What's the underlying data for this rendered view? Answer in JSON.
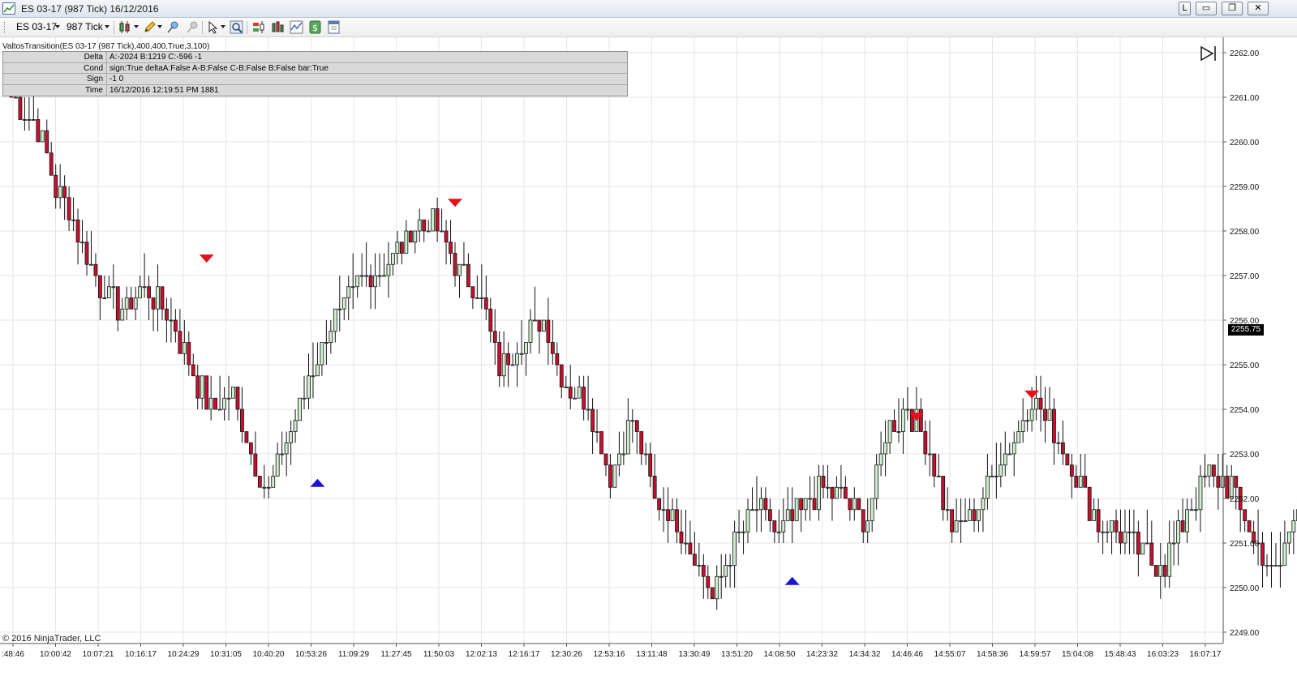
{
  "window": {
    "title": "ES 03-17 (987 Tick)  16/12/2016",
    "buttons": [
      "L",
      "▭",
      "❐",
      "✕"
    ]
  },
  "toolbar": {
    "instrument": "ES 03-17",
    "interval": "987 Tick"
  },
  "indicator": {
    "label": "ValtosTransition(ES 03-17 (987 Tick),400,400,True,3,100)",
    "rows": [
      {
        "key": "Delta",
        "value": "A:-2024 B:1219 C:-596 -1"
      },
      {
        "key": "Cond",
        "value": "sign:True deltaA:False A-B:False C-B:False B:False bar:True"
      },
      {
        "key": "Sign",
        "value": "-1 0"
      },
      {
        "key": "Time",
        "value": "16/12/2016 12:19:51 PM 1881"
      }
    ]
  },
  "copyright": "© 2016 NinjaTrader, LLC",
  "last_price": "2255.75",
  "colors": {
    "up_candle": "#cfeecf",
    "down_candle": "#c8102e",
    "sell_marker": "#e8101a",
    "buy_marker": "#1a14d8",
    "grid": "#e6e6e6"
  },
  "chart_data": {
    "type": "candlestick",
    "ylim": [
      2248.75,
      2262.25
    ],
    "y_ticks": [
      "2249.00",
      "2250.00",
      "2251.00",
      "2252.00",
      "2253.00",
      "2254.00",
      "2255.00",
      "2256.00",
      "2257.00",
      "2258.00",
      "2259.00",
      "2260.00",
      "2261.00",
      "2262.00"
    ],
    "x_ticks": [
      ":48:46",
      "10:00:42",
      "10:07:21",
      "10:16:17",
      "10:24:29",
      "10:31:05",
      "10:40:20",
      "10:53:26",
      "11:09:29",
      "11:27:45",
      "11:50:03",
      "12:02:13",
      "12:16:17",
      "12:30:26",
      "12:53:16",
      "13:11:48",
      "13:30:49",
      "13:51:20",
      "14:08:50",
      "14:23:32",
      "14:34:32",
      "14:46:46",
      "14:55:07",
      "14:58:36",
      "14:59:57",
      "15:04:08",
      "15:48:43",
      "16:03:23",
      "16:07:17"
    ],
    "anchors": [
      [
        0,
        2261.0
      ],
      [
        5,
        2260.5
      ],
      [
        10,
        2259.0
      ],
      [
        15,
        2258.0
      ],
      [
        20,
        2256.75
      ],
      [
        25,
        2256.25
      ],
      [
        30,
        2256.75
      ],
      [
        35,
        2256.25
      ],
      [
        40,
        2255.0
      ],
      [
        45,
        2254.0
      ],
      [
        50,
        2254.25
      ],
      [
        55,
        2252.75
      ],
      [
        58,
        2252.25
      ],
      [
        63,
        2253.5
      ],
      [
        68,
        2255.0
      ],
      [
        73,
        2256.0
      ],
      [
        78,
        2256.75
      ],
      [
        85,
        2257.25
      ],
      [
        90,
        2258.0
      ],
      [
        95,
        2258.25
      ],
      [
        100,
        2257.25
      ],
      [
        105,
        2256.75
      ],
      [
        110,
        2255.0
      ],
      [
        115,
        2255.5
      ],
      [
        120,
        2256.0
      ],
      [
        125,
        2254.5
      ],
      [
        130,
        2254.25
      ],
      [
        135,
        2252.5
      ],
      [
        140,
        2253.75
      ],
      [
        145,
        2252.0
      ],
      [
        150,
        2251.5
      ],
      [
        155,
        2250.5
      ],
      [
        158,
        2249.75
      ],
      [
        163,
        2251.0
      ],
      [
        168,
        2251.75
      ],
      [
        173,
        2251.25
      ],
      [
        178,
        2251.75
      ],
      [
        183,
        2252.25
      ],
      [
        188,
        2252.0
      ],
      [
        193,
        2251.5
      ],
      [
        197,
        2253.5
      ],
      [
        202,
        2254.0
      ],
      [
        207,
        2253.0
      ],
      [
        212,
        2251.25
      ],
      [
        217,
        2251.75
      ],
      [
        222,
        2252.75
      ],
      [
        226,
        2253.25
      ],
      [
        230,
        2254.25
      ],
      [
        235,
        2253.5
      ],
      [
        240,
        2252.5
      ],
      [
        245,
        2251.5
      ],
      [
        250,
        2251.25
      ],
      [
        255,
        2250.75
      ],
      [
        260,
        2250.5
      ],
      [
        265,
        2251.75
      ],
      [
        270,
        2252.5
      ],
      [
        275,
        2252.25
      ],
      [
        280,
        2251.0
      ],
      [
        285,
        2250.25
      ],
      [
        290,
        2252.0
      ],
      [
        295,
        2253.75
      ],
      [
        300,
        2253.25
      ],
      [
        305,
        2251.5
      ],
      [
        310,
        2251.0
      ],
      [
        315,
        2252.25
      ],
      [
        320,
        2253.75
      ],
      [
        325,
        2254.0
      ],
      [
        330,
        2254.75
      ],
      [
        335,
        2255.25
      ],
      [
        340,
        2255.0
      ],
      [
        345,
        2255.25
      ],
      [
        350,
        2254.0
      ],
      [
        355,
        2255.75
      ]
    ],
    "signals": [
      {
        "type": "sell",
        "bar": 44,
        "price": 2257.4
      },
      {
        "type": "sell",
        "bar": 100,
        "price": 2258.65
      },
      {
        "type": "buy",
        "bar": 69,
        "price": 2252.35
      },
      {
        "type": "buy",
        "bar": 176,
        "price": 2250.15
      },
      {
        "type": "sell",
        "bar": 204,
        "price": 2253.85
      },
      {
        "type": "sell",
        "bar": 230,
        "price": 2254.35
      }
    ]
  }
}
